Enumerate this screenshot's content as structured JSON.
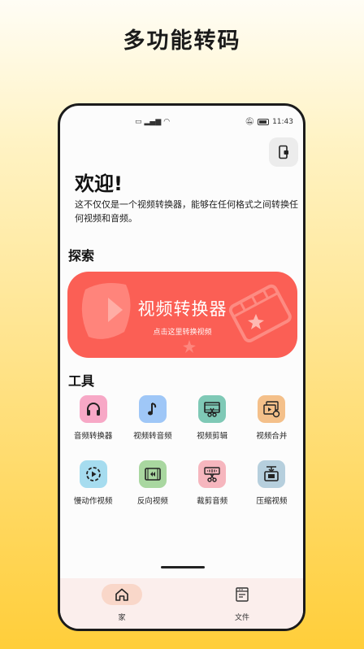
{
  "headline": "多功能转码",
  "status": {
    "time": "11:43"
  },
  "welcome": {
    "title": "欢迎!",
    "text": "这不仅仅是一个视频转换器，能够在任何格式之间转换任何视频和音频。"
  },
  "explore": {
    "title": "探索"
  },
  "banner": {
    "title": "视频转换器",
    "subtitle": "点击这里转换视频"
  },
  "tools": {
    "title": "工具",
    "items": [
      {
        "label": "音频转换器",
        "icon": "headphones-icon",
        "color": "#f7a8c6"
      },
      {
        "label": "视频转音频",
        "icon": "music-note-icon",
        "color": "#9fc7f7"
      },
      {
        "label": "视频剪辑",
        "icon": "film-scissors-icon",
        "color": "#7fc9b6"
      },
      {
        "label": "视频合并",
        "icon": "stacked-videos-icon",
        "color": "#f4c08a"
      },
      {
        "label": "慢动作视频",
        "icon": "slow-motion-icon",
        "color": "#a6dcef"
      },
      {
        "label": "反向视频",
        "icon": "reverse-video-icon",
        "color": "#a9d7a0"
      },
      {
        "label": "裁剪音频",
        "icon": "audio-cut-icon",
        "color": "#f6b6be"
      },
      {
        "label": "压缩视频",
        "icon": "compress-icon",
        "color": "#b6cfdd"
      }
    ]
  },
  "nav": {
    "home_label": "家",
    "files_label": "文件"
  },
  "colors": {
    "accent": "#fb5f55",
    "nav_bg": "#fbeeec",
    "nav_active": "#f9d7c9"
  }
}
